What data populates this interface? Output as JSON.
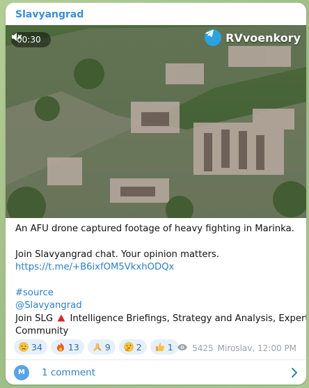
{
  "channel": {
    "name": "Slavyangrad"
  },
  "video": {
    "time": "00:30",
    "watermark": "RVvoenkory",
    "muted_icon": "speaker-muted-icon",
    "brand_icon": "telegram-logo-icon"
  },
  "caption": {
    "line1": "An AFU drone captured footage of heavy fighting in Marinka.",
    "line2": "Join Slavyangrad chat. Your opinion matters.",
    "link": "https://t.me/+B6ixfOM5VkxhODQx",
    "hashtag": "#source",
    "mention": "@Slavyangrad",
    "join_prefix": "Join SLG",
    "join_icon": "red-triangle-icon",
    "join_rest": "Intelligence Briefings, Strategy and Analysis, Expert",
    "join_rest2": "Community"
  },
  "reactions": [
    {
      "icon": "sad-face-emoji",
      "count": "34"
    },
    {
      "icon": "fire-emoji",
      "count": "13"
    },
    {
      "icon": "praying-hands-emoji",
      "count": "9"
    },
    {
      "icon": "thinking-face-emoji",
      "count": "2"
    },
    {
      "icon": "thumbs-up-emoji",
      "count": "1"
    }
  ],
  "meta": {
    "views": "5425",
    "author_time": "Miroslav, 12:00 PM",
    "views_icon": "eye-icon"
  },
  "comments": {
    "avatar_letter": "M",
    "label": "1 comment",
    "chevron_icon": "chevron-right-icon"
  },
  "colors": {
    "accent": "#3a8fd6",
    "link": "#2b7fc4",
    "reaction_bg": "#e6f0fa",
    "chat_bg": "#a9c48e"
  }
}
